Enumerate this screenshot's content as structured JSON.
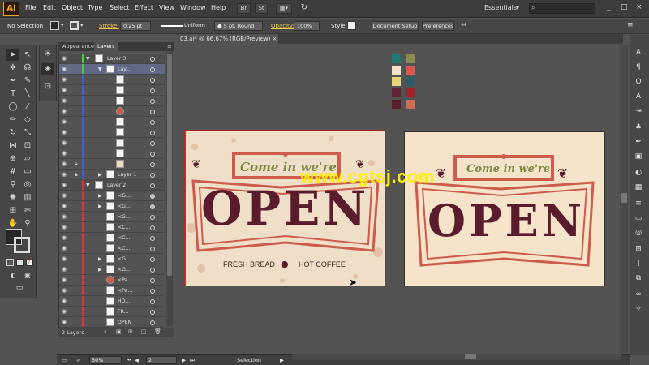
{
  "app": {
    "logo": "Ai",
    "menu": [
      "File",
      "Edit",
      "Object",
      "Type",
      "Select",
      "Effect",
      "View",
      "Window",
      "Help"
    ],
    "menu_buttons": [
      "Br",
      "St"
    ],
    "workspace": "Essentials",
    "window_controls": [
      "_",
      "□",
      "×"
    ]
  },
  "control_bar": {
    "selection": "No Selection",
    "stroke_label": "Stroke:",
    "stroke_weight": "0.25 pt",
    "profile": "Uniform",
    "brush": "5 pt. Round",
    "opacity_label": "Opacity:",
    "opacity_value": "100%",
    "style_label": "Style:",
    "document_setup": "Document Setup",
    "preferences": "Preferences"
  },
  "document": {
    "tab_title": "03.ai* @ 66.67% (RGB/Preview)"
  },
  "layers_panel": {
    "tabs": [
      "Appearance",
      "Layers"
    ],
    "active_tab": "Layers",
    "layer3": "Layer 3",
    "layer3_sub": "Lay...",
    "layer1": "Layer 1",
    "layer2": "Layer 2",
    "rows_layer2": [
      "<G...",
      "<G...",
      "<G...",
      "<C...",
      "<C...",
      "<C...",
      "<G...",
      "<G...",
      "<Pa...",
      "<Pa...",
      "HO...",
      "FR...",
      "OPEN",
      "<Pa..."
    ],
    "count": "2 Layers"
  },
  "swatches": {
    "colors": [
      "#1f7a72",
      "#8a8b4c",
      "#f3e2c8",
      "#d8584d",
      "#e8d47c",
      "#2f5d66",
      "#652136",
      "#a4202c",
      "#5a1d2b",
      "#cf6d56"
    ]
  },
  "artboards": {
    "banner_text": "Come in we're",
    "main_text": "OPEN",
    "left_item": "FRESH BREAD",
    "right_item": "HOT COFFEE",
    "colors": {
      "red": "#cd5c4d",
      "maroon": "#5a1c2c",
      "olive": "#7b8a45",
      "cream": "#f5e4c9"
    }
  },
  "watermark": "www.cgtsj.com",
  "status_bar": {
    "zoom": "50%",
    "page": "2",
    "tool": "Selection"
  }
}
